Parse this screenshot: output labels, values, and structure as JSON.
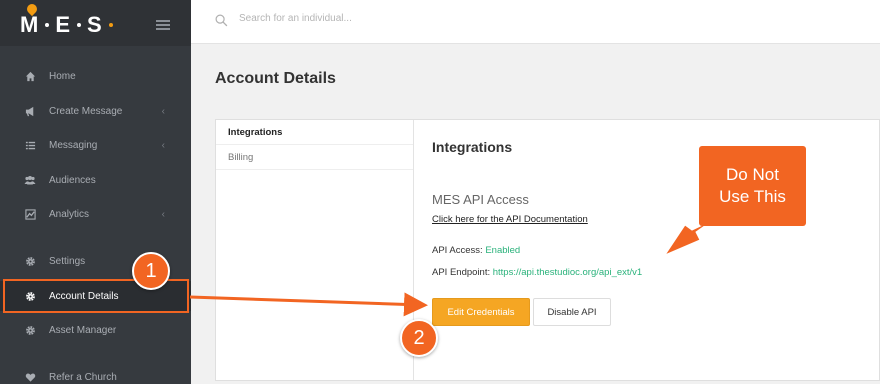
{
  "brand": {
    "logo_text": "M·E·S",
    "accent": "#f39c12"
  },
  "sidebar": {
    "items": [
      {
        "label": "Home",
        "icon": "home-icon",
        "chevron": ""
      },
      {
        "label": "Create Message",
        "icon": "megaphone-icon",
        "chevron": "‹"
      },
      {
        "label": "Messaging",
        "icon": "list-icon",
        "chevron": "‹"
      },
      {
        "label": "Audiences",
        "icon": "users-icon",
        "chevron": ""
      },
      {
        "label": "Analytics",
        "icon": "chart-icon",
        "chevron": "‹"
      },
      {
        "label": "Settings",
        "icon": "gear-icon",
        "chevron": ""
      },
      {
        "label": "Account Details",
        "icon": "gear-icon",
        "chevron": "",
        "active": true
      },
      {
        "label": "Asset Manager",
        "icon": "gear-icon",
        "chevron": ""
      },
      {
        "label": "Refer a Church",
        "icon": "heart-icon",
        "chevron": ""
      }
    ]
  },
  "search": {
    "placeholder": "Search for an individual..."
  },
  "page": {
    "title": "Account Details"
  },
  "tabs": [
    {
      "label": "Integrations",
      "active": true
    },
    {
      "label": "Billing",
      "active": false
    }
  ],
  "integrations": {
    "title": "Integrations",
    "api_title": "MES API Access",
    "doc_link": "Click here for the API Documentation",
    "api_access_label": "API Access:",
    "api_access_value": "Enabled",
    "api_endpoint_label": "API Endpoint:",
    "api_endpoint_value": "https://api.thestudioc.org/api_ext/v1",
    "edit_button": "Edit Credentials",
    "disable_button": "Disable API"
  },
  "annotations": {
    "badge_1": "1",
    "badge_2": "2",
    "callout": "Do Not Use This",
    "color": "#f26522"
  }
}
